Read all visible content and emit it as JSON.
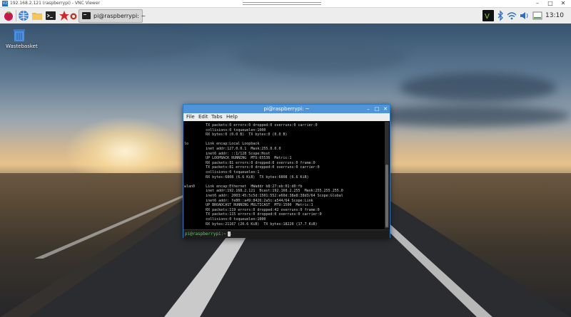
{
  "vnc": {
    "title": "192.168.2.121 (raspberrypi) - VNC Viewer",
    "logo": "V2"
  },
  "taskbar": {
    "task_label": "pi@raspberrypi: ~",
    "clock": "13:10"
  },
  "desktop": {
    "wastebasket_label": "Wastebasket"
  },
  "terminal": {
    "title": "pi@raspberrypi: ~",
    "menu": [
      "File",
      "Edit",
      "Tabs",
      "Help"
    ],
    "lines": [
      "          TX packets:0 errors:0 dropped:0 overruns:0 carrier:0",
      "          collisions:0 txqueuelen:1000",
      "          RX bytes:0 (0.0 B)  TX bytes:0 (0.0 B)",
      "",
      "lo        Link encap:Local Loopback",
      "          inet addr:127.0.0.1  Mask:255.0.0.0",
      "          inet6 addr: ::1/128 Scope:Host",
      "          UP LOOPBACK RUNNING  MTU:65536  Metric:1",
      "          RX packets:81 errors:0 dropped:0 overruns:0 frame:0",
      "          TX packets:81 errors:0 dropped:0 overruns:0 carrier:0",
      "          collisions:0 txqueuelen:1",
      "          RX bytes:6808 (6.6 KiB)  TX bytes:6808 (6.6 KiB)",
      "",
      "wlan0     Link encap:Ethernet  HWaddr b8:27:eb:01:d0:fb",
      "          inet addr:192.168.2.121  Bcast:192.168.2.255  Mask:255.255.255.0",
      "          inet6 addr: 2003:45:5c5d:1501:552:e60d:38e8:38d3/64 Scope:Global",
      "          inet6 addr: fe80::a49:8426:2a5c:a544/64 Scope:Link",
      "          UP BROADCAST RUNNING MULTICAST  MTU:1500  Metric:1",
      "          RX packets:119 errors:0 dropped:42 overruns:0 frame:0",
      "          TX packets:115 errors:0 dropped:0 overruns:0 carrier:0",
      "          collisions:0 txqueuelen:1000",
      "          RX bytes:21167 (20.6 KiB)  TX bytes:18220 (17.7 KiB)"
    ],
    "prompt": "pi@raspberrypi:~ $"
  }
}
